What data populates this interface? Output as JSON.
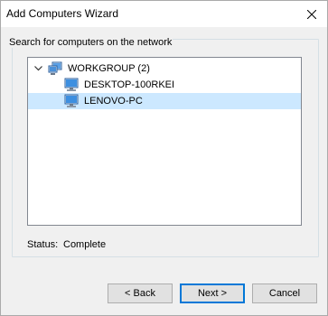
{
  "window": {
    "title": "Add Computers Wizard"
  },
  "group": {
    "label": "Search for computers on the network"
  },
  "tree": {
    "root": {
      "label": "WORKGROUP (2)",
      "icon": "network-workgroup-icon",
      "expanded": true
    },
    "children": [
      {
        "label": "DESKTOP-100RKEI",
        "icon": "computer-icon",
        "selected": false
      },
      {
        "label": "LENOVO-PC",
        "icon": "computer-icon",
        "selected": true
      }
    ]
  },
  "status": {
    "label": "Status:",
    "value": "Complete"
  },
  "buttons": {
    "back": "< Back",
    "next": "Next >",
    "cancel": "Cancel"
  },
  "colors": {
    "selection": "#cce8ff",
    "default_button_border": "#0078d7",
    "tree_border": "#828790"
  }
}
